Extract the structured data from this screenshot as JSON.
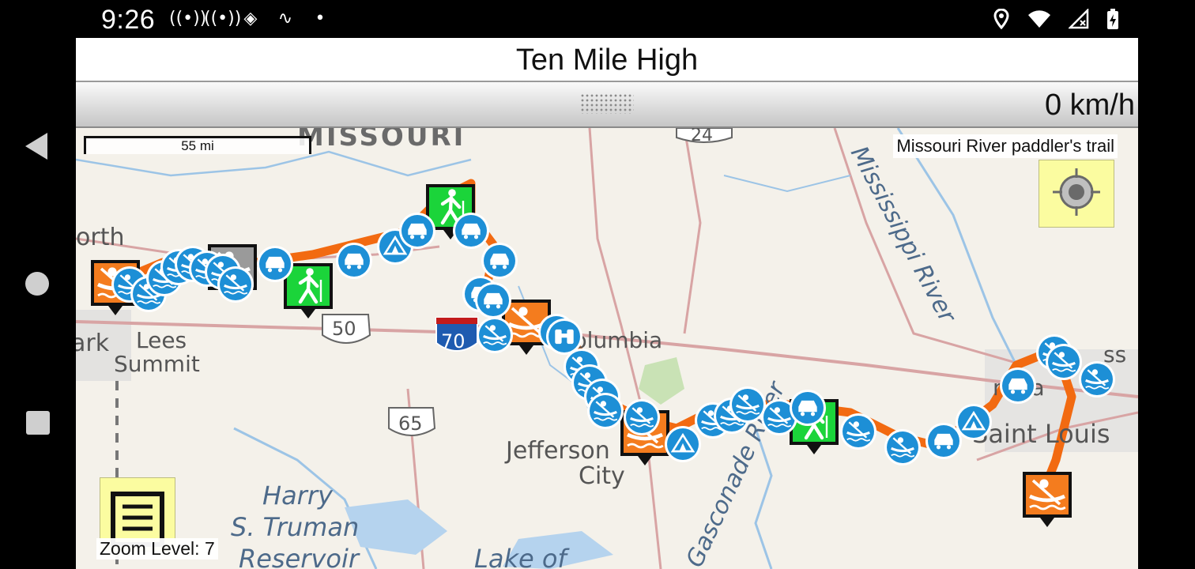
{
  "status_bar": {
    "time": "9:26",
    "left_icons": [
      "broadcast-icon",
      "broadcast-icon",
      "map-app-icon",
      "link-icon",
      "dot-icon"
    ],
    "right_icons": [
      "location-icon",
      "wifi-icon",
      "no-signal-icon",
      "battery-charging-icon"
    ]
  },
  "app": {
    "title": "Ten Mile High",
    "speed": "0 km/h"
  },
  "map": {
    "scale": "55 mi",
    "layer_name": "Missouri River paddler's trail",
    "zoom_level": "Zoom Level: 7",
    "labels": {
      "missouri": "MISSOURI",
      "north": "orth",
      "lees": "Lees",
      "summit": "Summit",
      "columbia": "Columbia",
      "jefferson": "Jefferson",
      "city": "City",
      "harry": "Harry",
      "truman": "S. Truman",
      "reservoir": "Reservoir",
      "lake": "Lake of",
      "saint_louis": "Saint Louis",
      "mississippi": "Mississippi River",
      "gasconade": "Gasconade River",
      "ark": "ark",
      "iss": "ss",
      "rssa": "rissa"
    },
    "shields": {
      "us50": "50",
      "i70": "70",
      "us65": "65",
      "us24": "24"
    },
    "colors": {
      "route": "#f26a11",
      "blue_marker": "#1d8fd6",
      "green_marker": "#1bd43a",
      "orange_marker": "#f47c1e",
      "panel_yellow": "#fbfca0"
    }
  }
}
